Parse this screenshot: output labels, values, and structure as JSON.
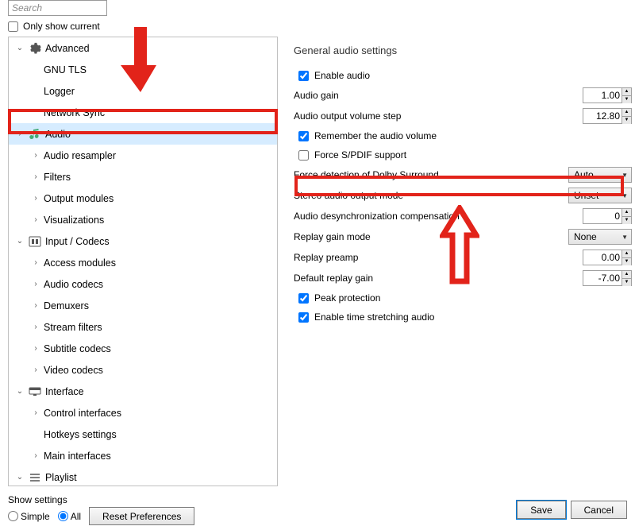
{
  "search": {
    "placeholder": "Search"
  },
  "only_current_label": "Only show current",
  "tree": {
    "advanced": "Advanced",
    "gnu_tls": "GNU TLS",
    "logger": "Logger",
    "network_sync": "Network Sync",
    "audio": "Audio",
    "audio_resampler": "Audio resampler",
    "filters": "Filters",
    "output_modules": "Output modules",
    "visualizations": "Visualizations",
    "input_codecs": "Input / Codecs",
    "access_modules": "Access modules",
    "audio_codecs": "Audio codecs",
    "demuxers": "Demuxers",
    "stream_filters": "Stream filters",
    "subtitle_codecs": "Subtitle codecs",
    "video_codecs": "Video codecs",
    "interface": "Interface",
    "control_interfaces": "Control interfaces",
    "hotkeys_settings": "Hotkeys settings",
    "main_interfaces": "Main interfaces",
    "playlist": "Playlist"
  },
  "detail": {
    "section_title": "General audio settings",
    "enable_audio": "Enable audio",
    "audio_gain": "Audio gain",
    "audio_gain_val": "1.00",
    "volume_step": "Audio output volume step",
    "volume_step_val": "12.80",
    "remember_volume": "Remember the audio volume",
    "force_spdif": "Force S/PDIF support",
    "dolby": "Force detection of Dolby Surround",
    "dolby_val": "Auto",
    "stereo_mode": "Stereo audio output mode",
    "stereo_mode_val": "Unset",
    "desync": "Audio desynchronization compensation",
    "desync_val": "0",
    "replay_mode": "Replay gain mode",
    "replay_mode_val": "None",
    "replay_preamp": "Replay preamp",
    "replay_preamp_val": "0.00",
    "default_replay": "Default replay gain",
    "default_replay_val": "-7.00",
    "peak_protection": "Peak protection",
    "time_stretch": "Enable time stretching audio"
  },
  "footer": {
    "show_settings": "Show settings",
    "simple": "Simple",
    "all": "All",
    "reset": "Reset Preferences",
    "save": "Save",
    "cancel": "Cancel"
  }
}
